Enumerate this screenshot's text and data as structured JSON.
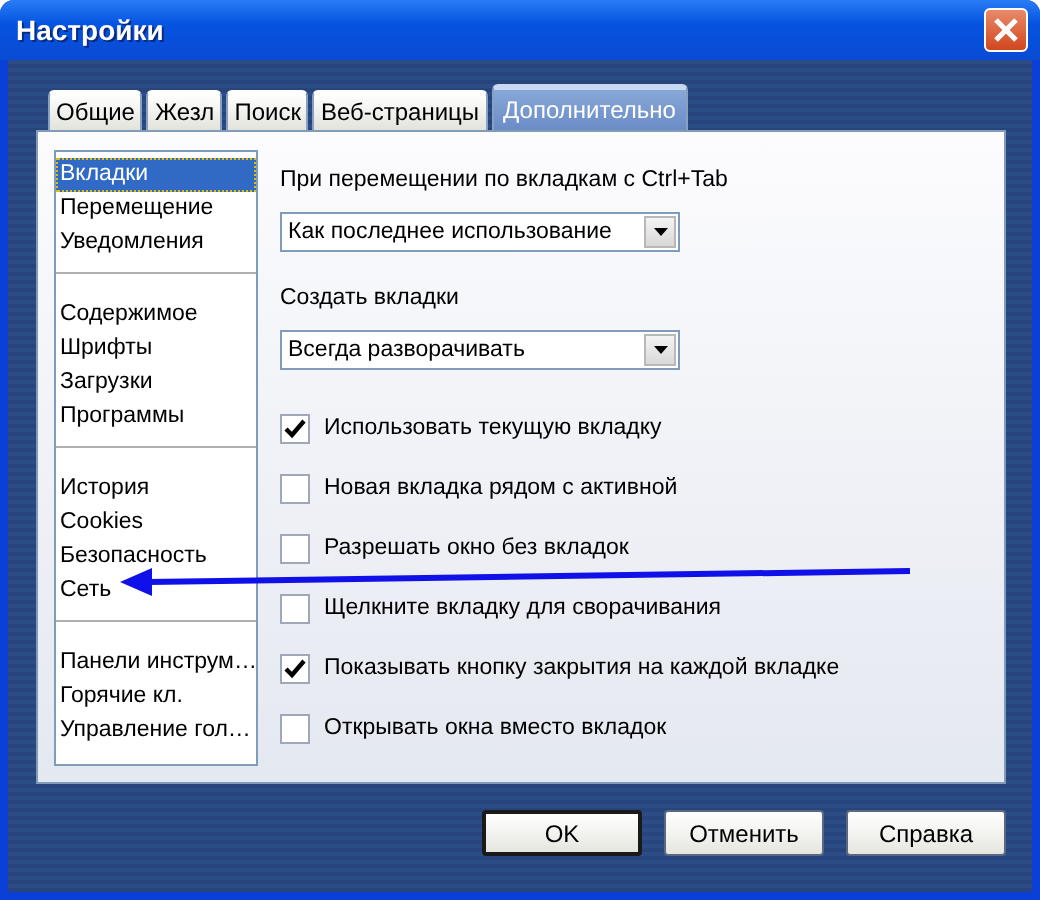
{
  "window": {
    "title": "Настройки"
  },
  "tabs": [
    {
      "label": "Общие",
      "selected": false
    },
    {
      "label": "Жезл",
      "selected": false
    },
    {
      "label": "Поиск",
      "selected": false
    },
    {
      "label": "Веб-страницы",
      "selected": false
    },
    {
      "label": "Дополнительно",
      "selected": true
    }
  ],
  "sidebar": {
    "groups": [
      {
        "items": [
          {
            "label": "Вкладки",
            "selected": true
          },
          {
            "label": "Перемещение",
            "selected": false
          },
          {
            "label": "Уведомления",
            "selected": false
          }
        ]
      },
      {
        "items": [
          {
            "label": "Содержимое",
            "selected": false
          },
          {
            "label": "Шрифты",
            "selected": false
          },
          {
            "label": "Загрузки",
            "selected": false
          },
          {
            "label": "Программы",
            "selected": false
          }
        ]
      },
      {
        "items": [
          {
            "label": "История",
            "selected": false
          },
          {
            "label": "Cookies",
            "selected": false
          },
          {
            "label": "Безопасность",
            "selected": false
          },
          {
            "label": "Сеть",
            "selected": false
          }
        ]
      },
      {
        "items": [
          {
            "label": "Панели инструм…",
            "selected": false
          },
          {
            "label": "Горячие кл.",
            "selected": false
          },
          {
            "label": "Управление гол…",
            "selected": false
          }
        ]
      }
    ]
  },
  "content": [
    {
      "kind": "label",
      "text": "При перемещении по вкладкам с Ctrl+Tab"
    },
    {
      "kind": "dropdown",
      "value": "Как последнее использование"
    },
    {
      "kind": "label",
      "text": "Создать вкладки"
    },
    {
      "kind": "dropdown",
      "value": "Всегда разворачивать"
    },
    {
      "kind": "checkbox",
      "label": "Использовать текущую вкладку",
      "checked": true
    },
    {
      "kind": "checkbox",
      "label": "Новая вкладка рядом с активной",
      "checked": false
    },
    {
      "kind": "checkbox",
      "label": "Разрешать окно без вкладок",
      "checked": false
    },
    {
      "kind": "checkbox",
      "label": "Щелкните вкладку для сворачивания",
      "checked": false
    },
    {
      "kind": "checkbox",
      "label": "Показывать кнопку закрытия на каждой вкладке",
      "checked": true
    },
    {
      "kind": "checkbox",
      "label": "Открывать окна вместо вкладок",
      "checked": false
    }
  ],
  "buttons": [
    {
      "label": "OK",
      "default": true
    },
    {
      "label": "Отменить",
      "default": false
    },
    {
      "label": "Справка",
      "default": false
    }
  ]
}
